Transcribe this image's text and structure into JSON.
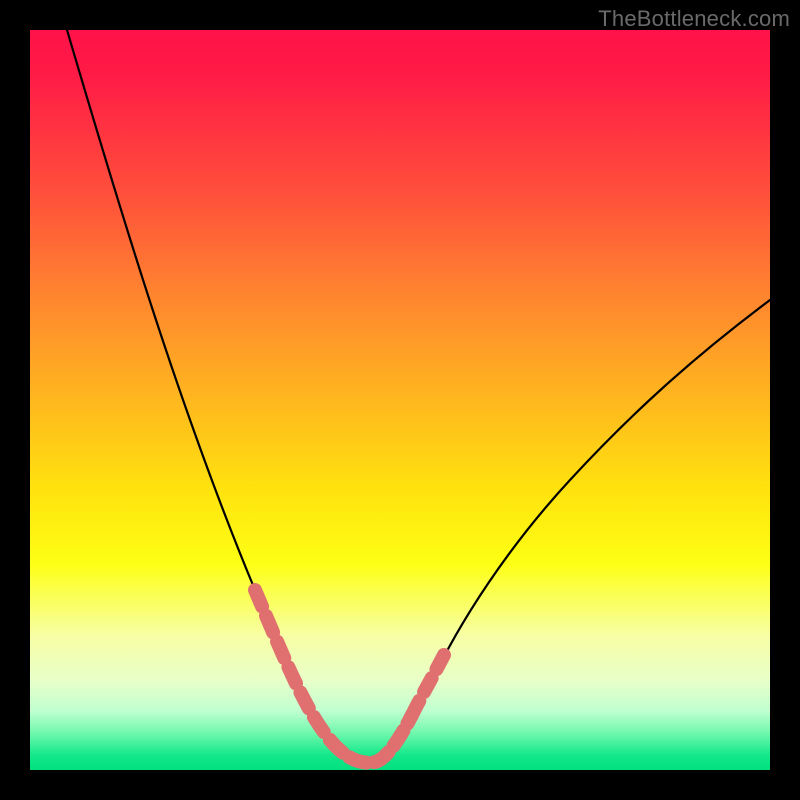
{
  "watermark": "TheBottleneck.com",
  "chart_data": {
    "type": "line",
    "title": "",
    "xlabel": "",
    "ylabel": "",
    "xlim": [
      0,
      100
    ],
    "ylim": [
      0,
      100
    ],
    "series": [
      {
        "name": "bottleneck-curve",
        "x": [
          5,
          10,
          15,
          20,
          25,
          30,
          32,
          34,
          36,
          38,
          40,
          42,
          44,
          46,
          48,
          50,
          55,
          60,
          65,
          70,
          75,
          80,
          85,
          90,
          95,
          100
        ],
        "values": [
          100,
          88,
          76,
          64,
          52,
          35,
          27,
          19,
          11,
          5,
          2,
          1,
          1,
          2,
          4,
          7,
          14,
          21,
          28,
          34,
          40,
          46,
          51,
          56,
          60,
          64
        ]
      }
    ],
    "highlight_segments": [
      {
        "x_start": 30,
        "x_end": 36
      },
      {
        "x_start": 36,
        "x_end": 48
      },
      {
        "x_start": 48,
        "x_end": 52
      }
    ],
    "gradient_stops": [
      {
        "offset": 0,
        "color": "#ff1249"
      },
      {
        "offset": 22,
        "color": "#ff4f3b"
      },
      {
        "offset": 48,
        "color": "#ffb021"
      },
      {
        "offset": 72,
        "color": "#feff14"
      },
      {
        "offset": 92,
        "color": "#c0ffd0"
      },
      {
        "offset": 100,
        "color": "#00e07e"
      }
    ]
  }
}
